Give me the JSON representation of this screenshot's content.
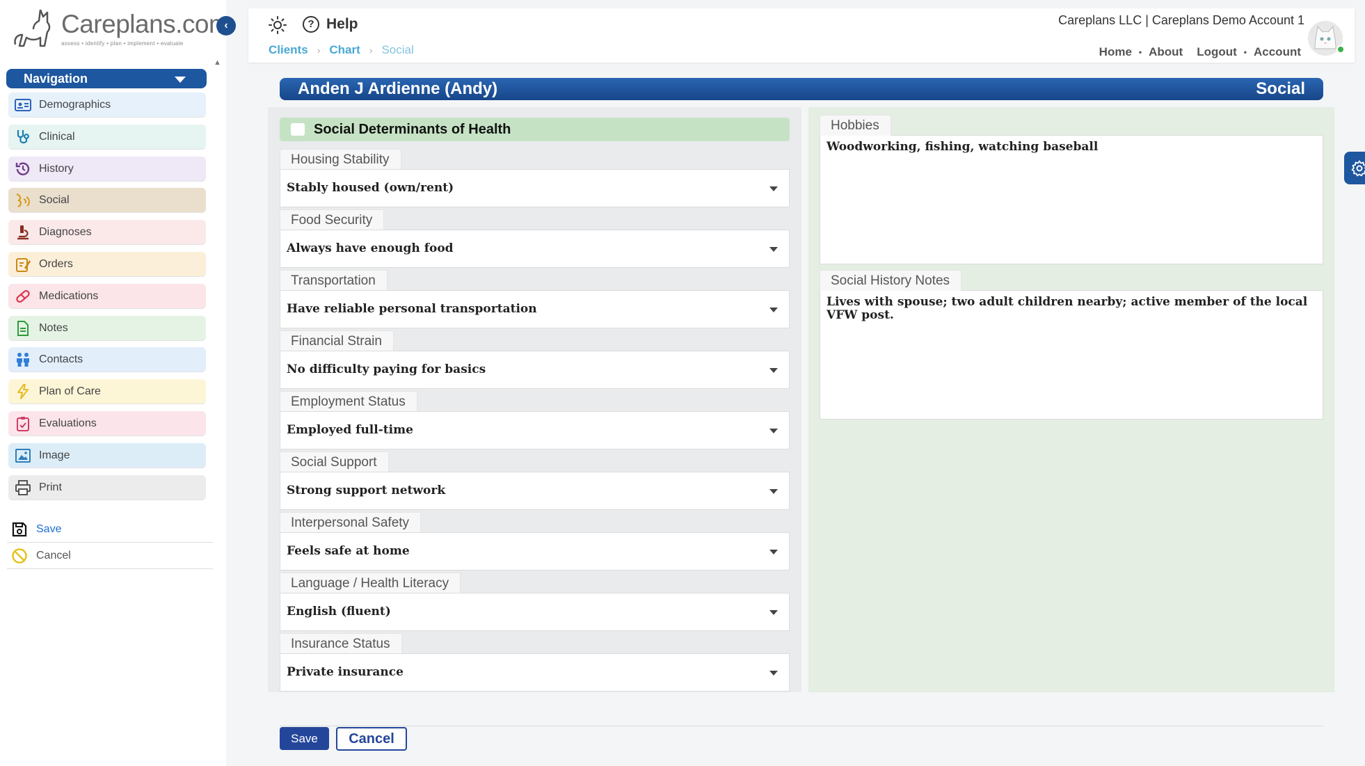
{
  "logo": {
    "text": "Careplans.com",
    "tagline": "assess • identify • plan • implement • evaluate"
  },
  "navigation": {
    "title": "Navigation",
    "items": [
      {
        "label": "Demographics",
        "icon": "id-card-icon",
        "bg": "#e6f1fb",
        "color": "#2e62b8"
      },
      {
        "label": "Clinical",
        "icon": "stethoscope-icon",
        "bg": "#e6f4f2",
        "color": "#1a7fb0"
      },
      {
        "label": "History",
        "icon": "history-icon",
        "bg": "#efe8f6",
        "color": "#6e3b8c"
      },
      {
        "label": "Social",
        "icon": "social-icon",
        "bg": "#eadfcd",
        "color": "#d89a1c"
      },
      {
        "label": "Diagnoses",
        "icon": "microscope-icon",
        "bg": "#fbe9ea",
        "color": "#8a2c1f"
      },
      {
        "label": "Orders",
        "icon": "clipboard-edit-icon",
        "bg": "#fcefd9",
        "color": "#c98a18"
      },
      {
        "label": "Medications",
        "icon": "pill-icon",
        "bg": "#fbe5e8",
        "color": "#d8344e"
      },
      {
        "label": "Notes",
        "icon": "note-icon",
        "bg": "#e5f3e4",
        "color": "#2f9a3c"
      },
      {
        "label": "Contacts",
        "icon": "people-icon",
        "bg": "#e3eefb",
        "color": "#2e7fd8"
      },
      {
        "label": "Plan of Care",
        "icon": "lightning-icon",
        "bg": "#fcf6d7",
        "color": "#e8b928"
      },
      {
        "label": "Evaluations",
        "icon": "clipboard-check-icon",
        "bg": "#fbe5ea",
        "color": "#d23b66"
      },
      {
        "label": "Image",
        "icon": "image-icon",
        "bg": "#dcedf8",
        "color": "#2f7dbd"
      },
      {
        "label": "Print",
        "icon": "printer-icon",
        "bg": "#ececec",
        "color": "#555555"
      }
    ]
  },
  "sidebar_actions": {
    "save": "Save",
    "cancel": "Cancel"
  },
  "header": {
    "help": "Help",
    "breadcrumb": [
      "Clients",
      "Chart",
      "Social"
    ],
    "account": "Careplans LLC | Careplans Demo Account 1",
    "links": {
      "home": "Home",
      "about": "About",
      "logout": "Logout",
      "account": "Account"
    }
  },
  "patient": {
    "name": "Anden J Ardienne (Andy)",
    "section": "Social"
  },
  "sdoh": {
    "title": "Social Determinants of Health",
    "fields": [
      {
        "label": "Housing Stability",
        "value": "Stably housed (own/rent)"
      },
      {
        "label": "Food Security",
        "value": "Always have enough food"
      },
      {
        "label": "Transportation",
        "value": "Have reliable personal transportation"
      },
      {
        "label": "Financial Strain",
        "value": "No difficulty paying for basics"
      },
      {
        "label": "Employment Status",
        "value": "Employed full-time"
      },
      {
        "label": "Social Support",
        "value": "Strong support network"
      },
      {
        "label": "Interpersonal Safety",
        "value": "Feels safe at home"
      },
      {
        "label": "Language / Health Literacy",
        "value": "English (fluent)"
      },
      {
        "label": "Insurance Status",
        "value": "Private insurance"
      }
    ]
  },
  "hobbies": {
    "label": "Hobbies",
    "value": "Woodworking, fishing, watching baseball"
  },
  "social_notes": {
    "label": "Social History Notes",
    "value": "Lives with spouse; two adult children nearby; active member of the local VFW post."
  },
  "footer": {
    "save": "Save",
    "cancel": "Cancel"
  },
  "colors": {
    "brand": "#1d57a0",
    "banner": "#1f5aa6",
    "sdoh_header": "#c5e3c4",
    "right_panel": "#e4eee2",
    "save_button": "#24469a",
    "breadcrumb_link": "#49a8d4"
  }
}
